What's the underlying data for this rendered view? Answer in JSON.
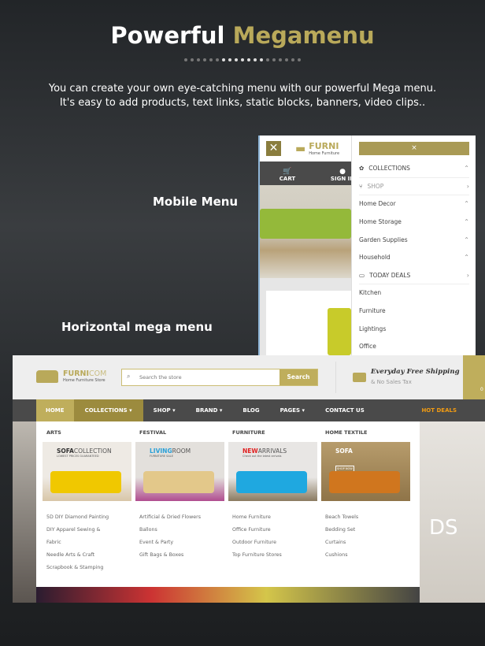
{
  "header": {
    "title_plain": "Powerful",
    "title_accent": "Megamenu",
    "subtitle_lines": [
      "You can create your own eye-catching menu with our powerful Mega menu.",
      "It's easy to add products, text links, static blocks, banners, video clips.."
    ]
  },
  "labels": {
    "mobile": "Mobile Menu",
    "horizontal": "Horizontal mega menu"
  },
  "colors": {
    "accent": "#b9a95a",
    "nav_bg": "#4a4a4a",
    "hot_deals": "#f39c12"
  },
  "mobile": {
    "logo": "FURNI",
    "logo_sub": "Home Furniture",
    "close_icon": "close-icon",
    "bar": [
      "CART",
      "SIGN IN"
    ],
    "panel_close": "×",
    "items": [
      {
        "label": "COLLECTIONS",
        "icon": "collections-icon",
        "chev": "^",
        "top": true
      },
      {
        "label": "SHOP",
        "icon": "utensils-icon",
        "chev": ">",
        "top": true
      },
      {
        "label": "Home Decor",
        "chev": "^"
      },
      {
        "label": "Home Storage",
        "chev": "^"
      },
      {
        "label": "Garden Supplies",
        "chev": "^"
      },
      {
        "label": "Household",
        "chev": "^"
      },
      {
        "label": "TODAY DEALS",
        "icon": "monitor-icon",
        "chev": ">",
        "top": true
      },
      {
        "label": "Kitchen"
      },
      {
        "label": "Furniture"
      },
      {
        "label": "Lightings"
      },
      {
        "label": "Office"
      }
    ]
  },
  "desktop": {
    "logo_a": "FURNI",
    "logo_b": "COM",
    "logo_sub": "Home Furniture Store",
    "search_placeholder": "Search the store",
    "search_button": "Search",
    "shipping_title": "Everyday Free Shipping",
    "shipping_sub": "& No Sales Tax",
    "cart_count": "0",
    "nav": [
      "HOME",
      "COLLECTIONS ▾",
      "SHOP ▾",
      "BRAND ▾",
      "BLOG",
      "PAGES ▾",
      "CONTACT US"
    ],
    "hot_deals": "HOT DEALS",
    "hero_text": "DS",
    "columns": [
      {
        "heading": "ARTS",
        "banner_a": "SOFA",
        "banner_b": "COLLECTION",
        "banner_sub": "LOWEST PRICES GUARANTEED",
        "links": [
          "5D DIY Diamond Painting",
          "DIY Apparel Sewing &",
          "Fabric",
          "Needle Arts & Craft",
          "Scrapbook & Stamping"
        ]
      },
      {
        "heading": "FESTIVAL",
        "banner_a": "LIVING",
        "banner_b": "ROOM",
        "banner_sub": "FURNITURE SALE",
        "links": [
          "Artificial & Dried Flowers",
          "Ballons",
          "Event & Party",
          "Gift Bags & Boxes"
        ]
      },
      {
        "heading": "FURNITURE",
        "banner_a": "NEW",
        "banner_b": "ARRIVALS",
        "banner_sub": "Check out the latest arrivals",
        "links": [
          "Home Furniture",
          "Office Furniture",
          "Outdoor Furniture",
          "Top Furniture Stores"
        ]
      },
      {
        "heading": "HOME TEXTILE",
        "banner_a": "SOFA",
        "banner_b": "",
        "banner_sub": "SHOP NOW",
        "links": [
          "Beach Towels",
          "Bedding Set",
          "Curtains",
          "Cushions"
        ]
      }
    ]
  }
}
